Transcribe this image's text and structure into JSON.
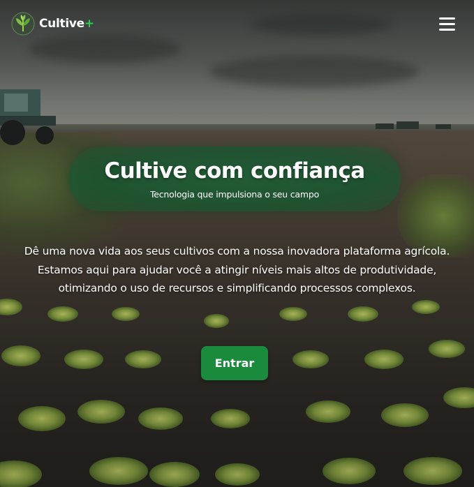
{
  "header": {
    "logo_name": "Cultive",
    "logo_plus": "+",
    "logo_icon": "sprout-leaf-icon",
    "menu_icon": "hamburger-menu-icon"
  },
  "hero": {
    "title": "Cultive com confiança",
    "subtitle": "Tecnologia que impulsiona o seu campo",
    "description": "Dê uma nova vida aos seus cultivos com a nossa inovadora plataforma agrícola. Estamos aqui para ajudar você a atingir níveis mais altos de produtividade, otimizando o uso de recursos e simplificando processos complexos.",
    "cta_label": "Entrar"
  },
  "colors": {
    "accent_green": "#1a8a3c",
    "logo_plus_green": "#2ecc52",
    "pill_green": "#1e5f37",
    "text_white": "#ffffff"
  }
}
